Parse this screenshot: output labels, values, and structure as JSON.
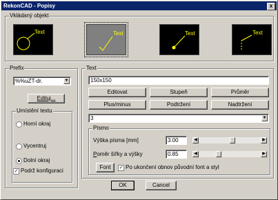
{
  "window": {
    "title": "RekonCAD - Popisy",
    "close_glyph": "x"
  },
  "insert_object": {
    "label": "Vkládaný objekt",
    "options": [
      {
        "text": "Text",
        "style": "circle",
        "selected": false
      },
      {
        "text": "Text",
        "style": "check-line",
        "selected": true
      },
      {
        "text": "Text",
        "style": "dot-line",
        "selected": false
      },
      {
        "text": "Text",
        "style": "dashed-line",
        "selected": false
      }
    ]
  },
  "prefix": {
    "label": "Prefix",
    "value": "%%uZT-dr.",
    "edit_label": "Edituj...",
    "placement": {
      "label": "Umístění textu",
      "options": [
        {
          "label": "Horní okraj",
          "checked": false
        },
        {
          "label": "Vycentruj",
          "checked": false
        },
        {
          "label": "Dolní okraj",
          "checked": true
        }
      ]
    },
    "keep_config": {
      "label": "Podrž konfiguraci",
      "checked": true
    }
  },
  "text": {
    "label": "Text",
    "value": "150x150",
    "buttons": [
      "Editovat",
      "Stupeň",
      "Průměr",
      "Plus/minus",
      "Podtržení",
      "Nadtržení"
    ],
    "dropdown_value": "3"
  },
  "font": {
    "label": "Písmo",
    "height_label": "Výška písma [mm]",
    "height_value": "3.00",
    "height_level": 0.55,
    "ratio_label": "Poměr šířky a výšky",
    "ratio_value": "0.85",
    "ratio_level": 0.3,
    "font_button": "Font",
    "restore": {
      "label": "Po ukončení obnov původní font a styl",
      "checked": true
    }
  },
  "ok_label": "OK",
  "cancel_label": "Cancel",
  "colors": {
    "title_bg": "#0a246a",
    "object_text": "#ffff00",
    "face": "#d4d0c8"
  },
  "icons": {
    "close": "close-icon",
    "dropdown": "chevron-down-icon",
    "left": "arrow-left-icon",
    "right": "arrow-right-icon"
  }
}
